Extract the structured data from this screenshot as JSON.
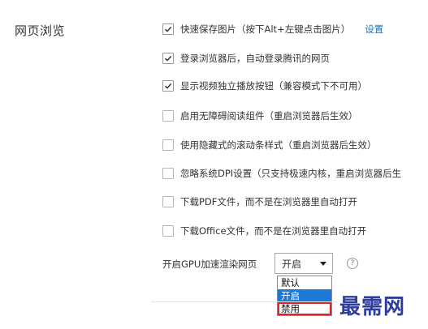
{
  "section_title": "网页浏览",
  "options": [
    {
      "label": "快速保存图片（按下Alt+左键点击图片）",
      "checked": true,
      "link": "设置"
    },
    {
      "label": "登录浏览器后，自动登录腾讯的网页",
      "checked": true
    },
    {
      "label": "显示视频独立播放按钮（兼容模式下不可用）",
      "checked": true
    },
    {
      "label": "启用无障碍阅读组件（重启浏览器后生效）",
      "checked": false
    },
    {
      "label": "使用隐藏式的滚动条样式（重启浏览器后生效）",
      "checked": false
    },
    {
      "label": "忽略系统DPI设置（只支持极速内核，重启浏览器后生",
      "checked": false
    },
    {
      "label": "下载PDF文件，而不是在浏览器里自动打开",
      "checked": false
    },
    {
      "label": "下载Office文件，而不是在浏览器里自动打开",
      "checked": false
    }
  ],
  "gpu": {
    "label": "开启GPU加速渲染网页",
    "selected": "开启",
    "help_glyph": "?",
    "dropdown_options": [
      "默认",
      "开启",
      "禁用"
    ]
  },
  "watermark": "最需网",
  "colors": {
    "link": "#1a73c8",
    "selection": "#1e78d6",
    "highlight_border": "#d9252b",
    "watermark": "#2d3d9c"
  }
}
